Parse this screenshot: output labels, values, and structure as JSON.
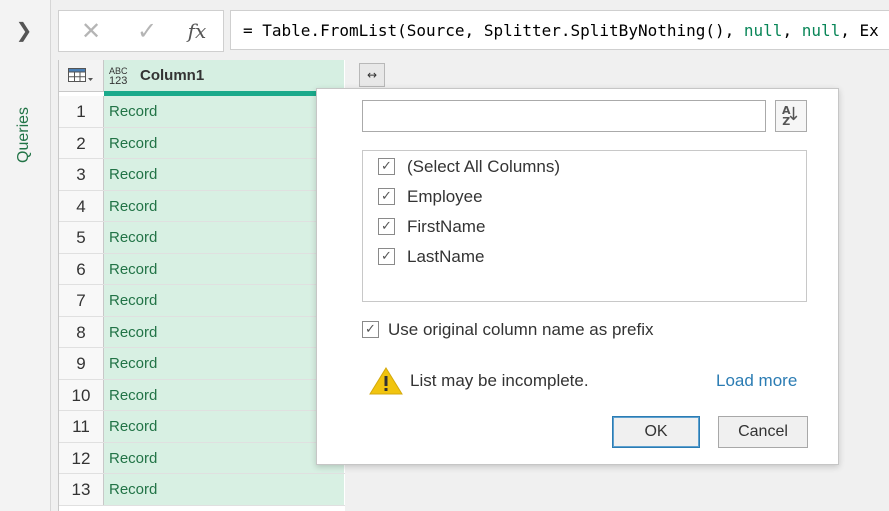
{
  "sidebar": {
    "expand_icon": "chevron-right-icon",
    "queries_label": "Queries"
  },
  "formula_bar": {
    "cancel_icon": "close-icon",
    "commit_icon": "check-icon",
    "fx_label": "fx",
    "formula_prefix": "= Table.FromList(Source, Splitter.SplitByNothing(), ",
    "formula_null1": "null",
    "formula_sep1": ", ",
    "formula_null2": "null",
    "formula_sep2": ", ",
    "formula_tail": "Ex"
  },
  "grid": {
    "column_type": "ABC\n123",
    "column_type_top": "ABC",
    "column_type_bottom": "123",
    "column_name": "Column1",
    "rows": [
      {
        "num": "1",
        "value": "Record"
      },
      {
        "num": "2",
        "value": "Record"
      },
      {
        "num": "3",
        "value": "Record"
      },
      {
        "num": "4",
        "value": "Record"
      },
      {
        "num": "5",
        "value": "Record"
      },
      {
        "num": "6",
        "value": "Record"
      },
      {
        "num": "7",
        "value": "Record"
      },
      {
        "num": "8",
        "value": "Record"
      },
      {
        "num": "9",
        "value": "Record"
      },
      {
        "num": "10",
        "value": "Record"
      },
      {
        "num": "11",
        "value": "Record"
      },
      {
        "num": "12",
        "value": "Record"
      },
      {
        "num": "13",
        "value": "Record"
      }
    ]
  },
  "expand_dropdown": {
    "search_value": "",
    "sort_label": "AZ",
    "sort_label_a": "A",
    "sort_label_z": "Z",
    "columns": [
      {
        "label": "(Select All Columns)",
        "checked": true
      },
      {
        "label": "Employee",
        "checked": true
      },
      {
        "label": "FirstName",
        "checked": true
      },
      {
        "label": "LastName",
        "checked": true
      }
    ],
    "prefix_label": "Use original column name as prefix",
    "prefix_checked": true,
    "warning_text": "List may be incomplete.",
    "load_more": "Load more",
    "ok_label": "OK",
    "cancel_label": "Cancel"
  },
  "colors": {
    "accent_green": "#217346",
    "teal_underline": "#1aaa8b",
    "link_blue": "#2b7cb3",
    "cell_green": "#d8f0e3",
    "warning_yellow": "#f1c40f"
  }
}
